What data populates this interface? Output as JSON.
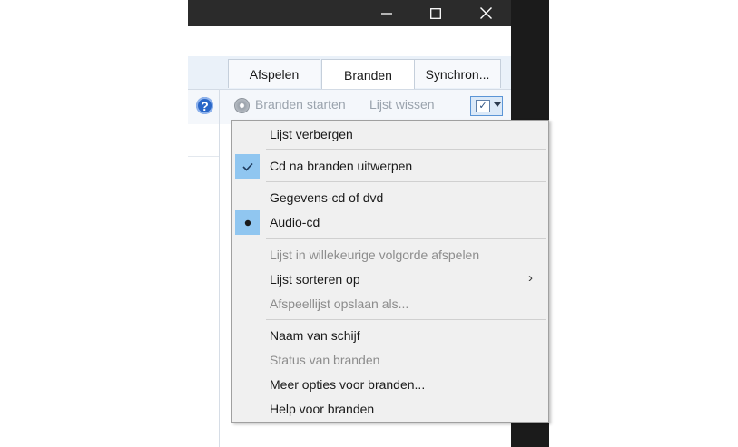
{
  "window": {
    "controls": {
      "minimize": "—",
      "maximize": "☐",
      "close": "✕"
    }
  },
  "tabs": [
    {
      "label": "Afspelen",
      "active": false
    },
    {
      "label": "Branden",
      "active": true
    },
    {
      "label": "Synchron...",
      "active": false
    }
  ],
  "toolbar": {
    "help_icon": "?",
    "start_label": "Branden starten",
    "clear_label": "Lijst wissen",
    "options_icon": "✓"
  },
  "menu": {
    "items": [
      {
        "label": "Lijst verbergen",
        "enabled": true
      },
      {
        "label": "Cd na branden uitwerpen",
        "enabled": true,
        "mark": "✓"
      },
      {
        "label": "Gegevens-cd of dvd",
        "enabled": true
      },
      {
        "label": "Audio-cd",
        "enabled": true,
        "mark": "●"
      },
      {
        "label": "Lijst in willekeurige volgorde afspelen",
        "enabled": false
      },
      {
        "label": "Lijst sorteren op",
        "enabled": true,
        "submenu": "›"
      },
      {
        "label": "Afspeellijst opslaan als...",
        "enabled": false
      },
      {
        "label": "Naam van schijf",
        "enabled": true
      },
      {
        "label": "Status van branden",
        "enabled": false
      },
      {
        "label": "Meer opties voor branden...",
        "enabled": true
      },
      {
        "label": "Help voor branden",
        "enabled": true
      }
    ]
  },
  "colors": {
    "titlebar": "#2b2b2b",
    "check_highlight": "#90c6f0",
    "disabled_text": "#8c8c8c"
  }
}
